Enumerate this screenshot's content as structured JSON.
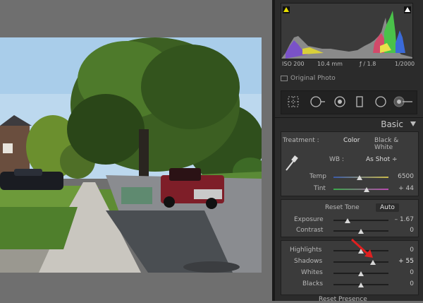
{
  "histogram": {
    "iso": "ISO 200",
    "focal": "10.4 mm",
    "aperture": "ƒ / 1.8",
    "shutter": "1/2000",
    "clip_color": "#e8e000"
  },
  "original_photo_label": "Original Photo",
  "tools": [
    "grid-icon",
    "spot-removal-icon",
    "red-eye-icon",
    "graduated-filter-icon",
    "radial-filter-icon",
    "adjustment-brush-icon"
  ],
  "basic": {
    "title": "Basic",
    "treatment_label": "Treatment :",
    "color_option": "Color",
    "bw_option": "Black & White",
    "wb_label": "WB :",
    "wb_value": "As Shot ÷",
    "temp_label": "Temp",
    "temp_value": "6500",
    "tint_label": "Tint",
    "tint_value": "+ 44",
    "reset_tone_label": "Reset Tone",
    "auto_label": "Auto",
    "exposure_label": "Exposure",
    "exposure_value": "– 1.67",
    "contrast_label": "Contrast",
    "contrast_value": "0",
    "highlights_label": "Highlights",
    "highlights_value": "0",
    "shadows_label": "Shadows",
    "shadows_value": "+ 55",
    "whites_label": "Whites",
    "whites_value": "0",
    "blacks_label": "Blacks",
    "blacks_value": "0",
    "presence_label": "Reset Presence"
  },
  "accent_arrow_color": "#e02020"
}
